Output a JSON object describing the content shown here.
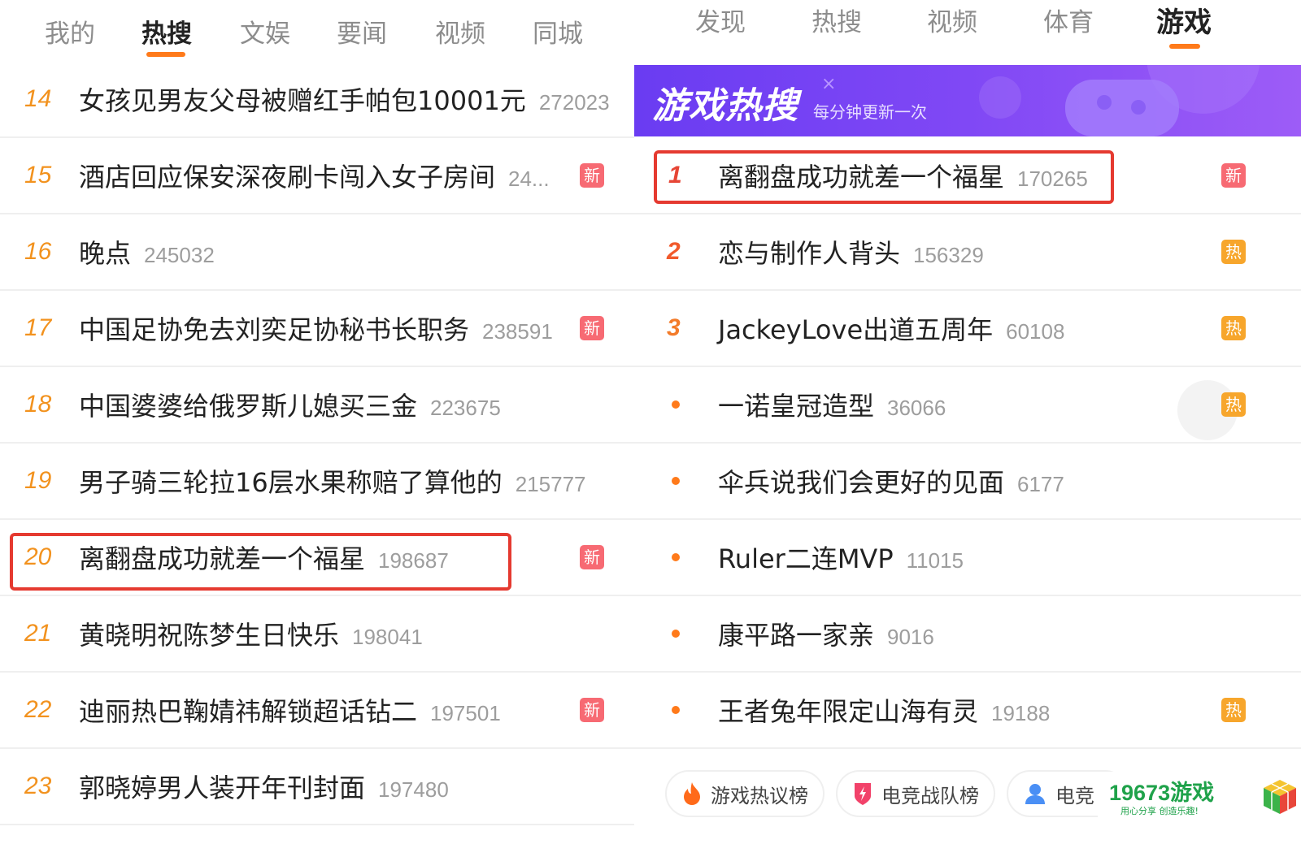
{
  "left": {
    "tabs": [
      "我的",
      "热搜",
      "文娱",
      "要闻",
      "视频",
      "同城"
    ],
    "active_tab_index": 1,
    "rows": [
      {
        "rank": "14",
        "title": "女孩见男友父母被赠红手帕包10001元",
        "count": "272023",
        "badge": ""
      },
      {
        "rank": "15",
        "title": "酒店回应保安深夜刷卡闯入女子房间",
        "count": "24...",
        "badge": "新"
      },
      {
        "rank": "16",
        "title": "晚点",
        "count": "245032",
        "badge": ""
      },
      {
        "rank": "17",
        "title": "中国足协免去刘奕足协秘书长职务",
        "count": "238591",
        "badge": "新"
      },
      {
        "rank": "18",
        "title": "中国婆婆给俄罗斯儿媳买三金",
        "count": "223675",
        "badge": ""
      },
      {
        "rank": "19",
        "title": "男子骑三轮拉16层水果称赔了算他的",
        "count": "215777",
        "badge": ""
      },
      {
        "rank": "20",
        "title": "离翻盘成功就差一个福星",
        "count": "198687",
        "badge": "新"
      },
      {
        "rank": "21",
        "title": "黄晓明祝陈梦生日快乐",
        "count": "198041",
        "badge": ""
      },
      {
        "rank": "22",
        "title": "迪丽热巴鞠婧祎解锁超话钻二",
        "count": "197501",
        "badge": "新"
      },
      {
        "rank": "23",
        "title": "郭晓婷男人装开年刊封面",
        "count": "197480",
        "badge": ""
      }
    ]
  },
  "right": {
    "tabs": [
      "发现",
      "热搜",
      "视频",
      "体育",
      "游戏"
    ],
    "active_tab_index": 4,
    "banner": {
      "title": "游戏热搜",
      "subtitle": "每分钟更新一次"
    },
    "rows": [
      {
        "rank": "1",
        "title": "离翻盘成功就差一个福星",
        "count": "170265",
        "badge": "新"
      },
      {
        "rank": "2",
        "title": "恋与制作人背头",
        "count": "156329",
        "badge": "热"
      },
      {
        "rank": "3",
        "title": "JackeyLove出道五周年",
        "count": "60108",
        "badge": "热"
      },
      {
        "rank": "",
        "title": "一诺皇冠造型",
        "count": "36066",
        "badge": "热"
      },
      {
        "rank": "",
        "title": "伞兵说我们会更好的见面",
        "count": "6177",
        "badge": ""
      },
      {
        "rank": "",
        "title": "Ruler二连MVP",
        "count": "11015",
        "badge": ""
      },
      {
        "rank": "",
        "title": "康平路一家亲",
        "count": "9016",
        "badge": ""
      },
      {
        "rank": "",
        "title": "王者兔年限定山海有灵",
        "count": "19188",
        "badge": "热"
      }
    ],
    "bottom_tags": [
      "游戏热议榜",
      "电竞战队榜",
      "电竞"
    ]
  },
  "watermark": {
    "main": "19673游戏",
    "sub": "用心分享 创造乐趣!"
  },
  "colors": {
    "accent": "#ff7a1a",
    "rank": "#f2921e",
    "new_badge": "#f76a73",
    "hot_badge": "#f7a62c",
    "highlight": "#e53a30",
    "banner": "#7b44f4"
  }
}
